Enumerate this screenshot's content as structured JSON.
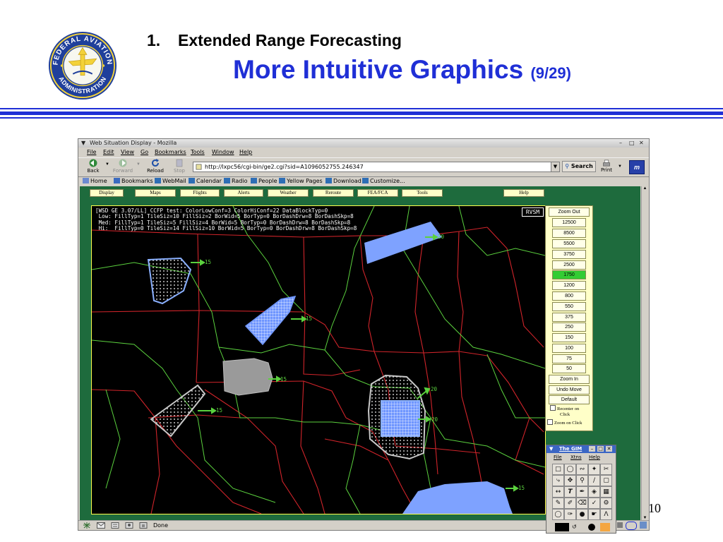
{
  "slide": {
    "heading_number": "1.",
    "heading": "Extended Range Forecasting",
    "title": "More Intuitive Graphics",
    "title_suffix": "(9/29)",
    "page_number": "10",
    "seal_text_top": "FEDERAL AVIATION",
    "seal_text_bottom": "ADMINISTRATION",
    "accent_color": "#1f2fd6"
  },
  "browser": {
    "window_title": "Web Situation Display - Mozilla",
    "menu": [
      "File",
      "Edit",
      "View",
      "Go",
      "Bookmarks",
      "Tools",
      "Window",
      "Help"
    ],
    "nav": {
      "back": "Back",
      "forward": "Forward",
      "reload": "Reload",
      "stop": "Stop",
      "print": "Print",
      "search": "Search"
    },
    "url": "http://lxpc56/cgi-bin/ge2.cgi?sid=A1096052755.246347",
    "bookmarks": [
      "Home",
      "Bookmarks",
      "WebMail",
      "Calendar",
      "Radio",
      "People",
      "Yellow Pages",
      "Download",
      "Customize..."
    ],
    "status": "Done"
  },
  "app": {
    "menu_buttons": [
      "Display",
      "Maps",
      "Flights",
      "Alerts",
      "Weather",
      "Reroute",
      "FEA/FCA",
      "Tools",
      "Help"
    ],
    "map_info_lines": [
      "[WSD GE 3.07/LL] CCFP test: ColorLowConf=3 ColorHiConf=22 DataBlockTyp=0",
      " Low: FillTyp=1 TileSiz=10 FillSiz=2 BorWid=5 BorTyp=0 BorDashDrw=8 BorDashSkp=8",
      " Med: FillTyp=1 TileSiz=5 FillSiz=4 BorWid=5 BorTyp=0 BorDashDrw=8 BorDashSkp=8",
      " Hi:  FillTyp=0 TileSiz=14 FillSiz=10 BorWid=5 BorTyp=0 BorDashDrw=8 BorDashSkp=8"
    ],
    "rvsm_label": "RVSM",
    "zoom_out": "Zoom Out",
    "altitudes": [
      "12500",
      "8500",
      "5500",
      "3750",
      "2500",
      "1750",
      "1200",
      "800",
      "550",
      "375",
      "250",
      "150",
      "100",
      "75",
      "50"
    ],
    "selected_altitude": "1750",
    "zoom_in": "Zoom In",
    "undo_move": "Undo Move",
    "default": "Default",
    "recenter_on_click_line1": "Recenter on",
    "recenter_on_click_line2": "Click",
    "zoom_on_click": "Zoom on Click",
    "storm_labels": [
      "15",
      "15",
      "15",
      "15",
      "20",
      "20",
      "20",
      "15"
    ]
  },
  "gim": {
    "title": "The GIM",
    "menu": [
      "File",
      "Xtns",
      "Help"
    ]
  }
}
